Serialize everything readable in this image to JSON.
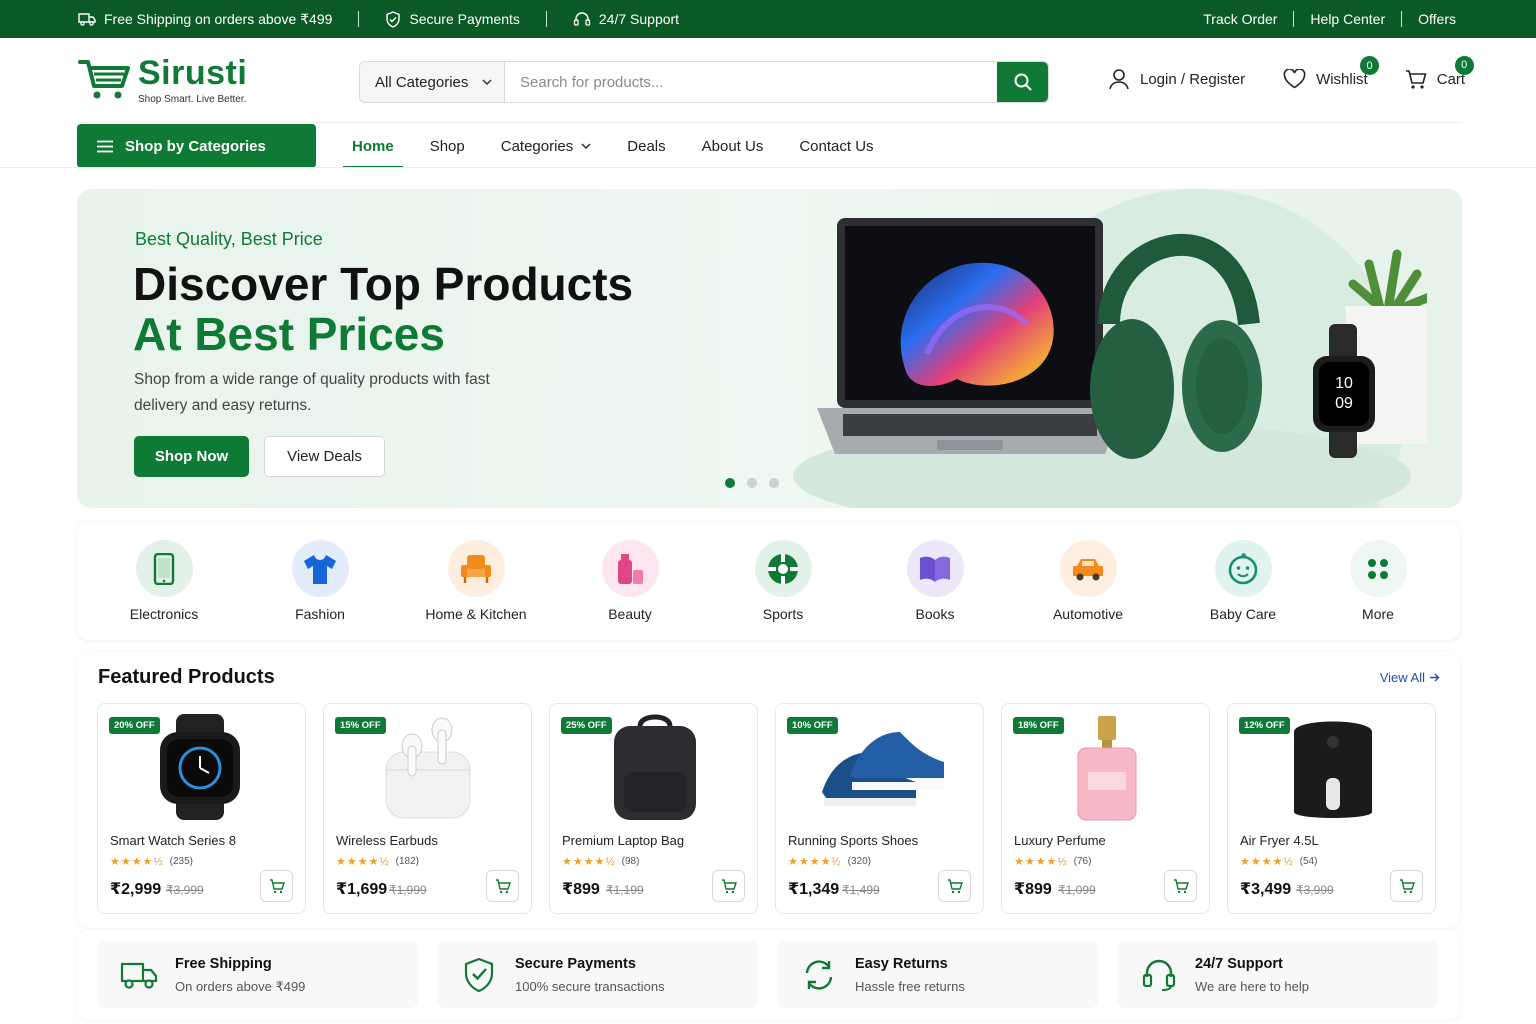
{
  "topbar": {
    "shipping": "Free Shipping on orders above ₹499",
    "secure": "Secure Payments",
    "support": "24/7 Support",
    "track": "Track Order",
    "help": "Help Center",
    "offers": "Offers"
  },
  "brand": {
    "name": "Sirusti",
    "tagline": "Shop Smart. Live Better.",
    "color": "#0e7a35"
  },
  "search": {
    "category": "All Categories",
    "placeholder": "Search for products..."
  },
  "account": {
    "login": "Login / Register",
    "wishlist": "Wishlist",
    "wishlist_count": "0",
    "cart": "Cart",
    "cart_count": "0"
  },
  "nav": {
    "shop_by": "Shop by Categories",
    "items": [
      "Home",
      "Shop",
      "Categories",
      "Deals",
      "About Us",
      "Contact Us"
    ],
    "active": "Home"
  },
  "hero": {
    "tag": "Best Quality, Best Price",
    "title_line1": "Discover Top Products",
    "title_line2": "At Best Prices",
    "description": "Shop from a wide range of quality products with fast delivery and easy returns.",
    "primary_button": "Shop Now",
    "secondary_button": "View Deals",
    "watch_time_h": "10",
    "watch_time_m": "09",
    "slide_active": 1,
    "slide_count": 3
  },
  "categories": [
    {
      "label": "Electronics",
      "icon": "smartphone-icon"
    },
    {
      "label": "Fashion",
      "icon": "tshirt-icon"
    },
    {
      "label": "Home & Kitchen",
      "icon": "armchair-icon"
    },
    {
      "label": "Beauty",
      "icon": "cosmetics-icon"
    },
    {
      "label": "Sports",
      "icon": "ball-icon"
    },
    {
      "label": "Books",
      "icon": "book-icon"
    },
    {
      "label": "Automotive",
      "icon": "car-icon"
    },
    {
      "label": "Baby Care",
      "icon": "baby-icon"
    },
    {
      "label": "More",
      "icon": "grid-icon"
    }
  ],
  "featured": {
    "title": "Featured Products",
    "view_all": "View All",
    "products": [
      {
        "discount": "20% OFF",
        "name": "Smart Watch Series 8",
        "reviews": "(235)",
        "price": "₹2,999",
        "old_price": "₹3,999",
        "rating": 4.5
      },
      {
        "discount": "15% OFF",
        "name": "Wireless Earbuds",
        "reviews": "(182)",
        "price": "₹1,699",
        "old_price": "₹1,999",
        "rating": 4.5
      },
      {
        "discount": "25% OFF",
        "name": "Premium Laptop Bag",
        "reviews": "(98)",
        "price": "₹899",
        "old_price": "₹1,199",
        "rating": 4.5
      },
      {
        "discount": "10% OFF",
        "name": "Running Sports Shoes",
        "reviews": "(320)",
        "price": "₹1,349",
        "old_price": "₹1,499",
        "rating": 4.5
      },
      {
        "discount": "18% OFF",
        "name": "Luxury Perfume",
        "reviews": "(76)",
        "price": "₹899",
        "old_price": "₹1,099",
        "rating": 4.5
      },
      {
        "discount": "12% OFF",
        "name": "Air Fryer 4.5L",
        "reviews": "(54)",
        "price": "₹3,499",
        "old_price": "₹3,999",
        "rating": 4.5
      }
    ]
  },
  "features": [
    {
      "title": "Free Shipping",
      "subtitle": "On orders above ₹499",
      "icon": "truck-icon"
    },
    {
      "title": "Secure Payments",
      "subtitle": "100% secure transactions",
      "icon": "shield-check-icon"
    },
    {
      "title": "Easy Returns",
      "subtitle": "Hassle free returns",
      "icon": "refresh-icon"
    },
    {
      "title": "24/7 Support",
      "subtitle": "We are here to help",
      "icon": "headset-icon"
    }
  ]
}
